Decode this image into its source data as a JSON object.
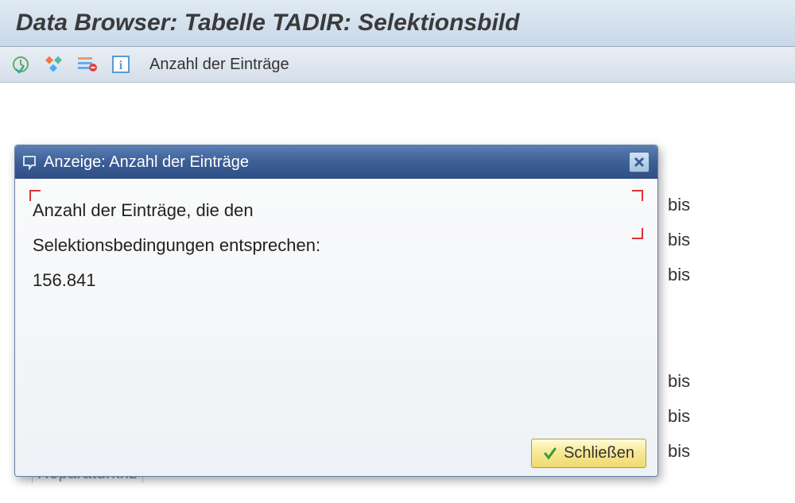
{
  "title": "Data Browser: Tabelle TADIR: Selektionsbild",
  "toolbar": {
    "execute_icon": "execute",
    "variants_icon": "variants",
    "list_icon": "settings-list",
    "info_icon": "info",
    "entries_label": "Anzahl der Einträge"
  },
  "dialog": {
    "title": "Anzeige: Anzahl der Einträge",
    "message_line1": "Anzahl der Einträge, die den",
    "message_line2": "Selektionsbedingungen entsprechen:",
    "count": "156.841",
    "close_label": "Schließen"
  },
  "form": {
    "bis_label": "bis",
    "rows_group1": 3,
    "rows_group2": 3,
    "partial_field": "Reparaturknz"
  }
}
